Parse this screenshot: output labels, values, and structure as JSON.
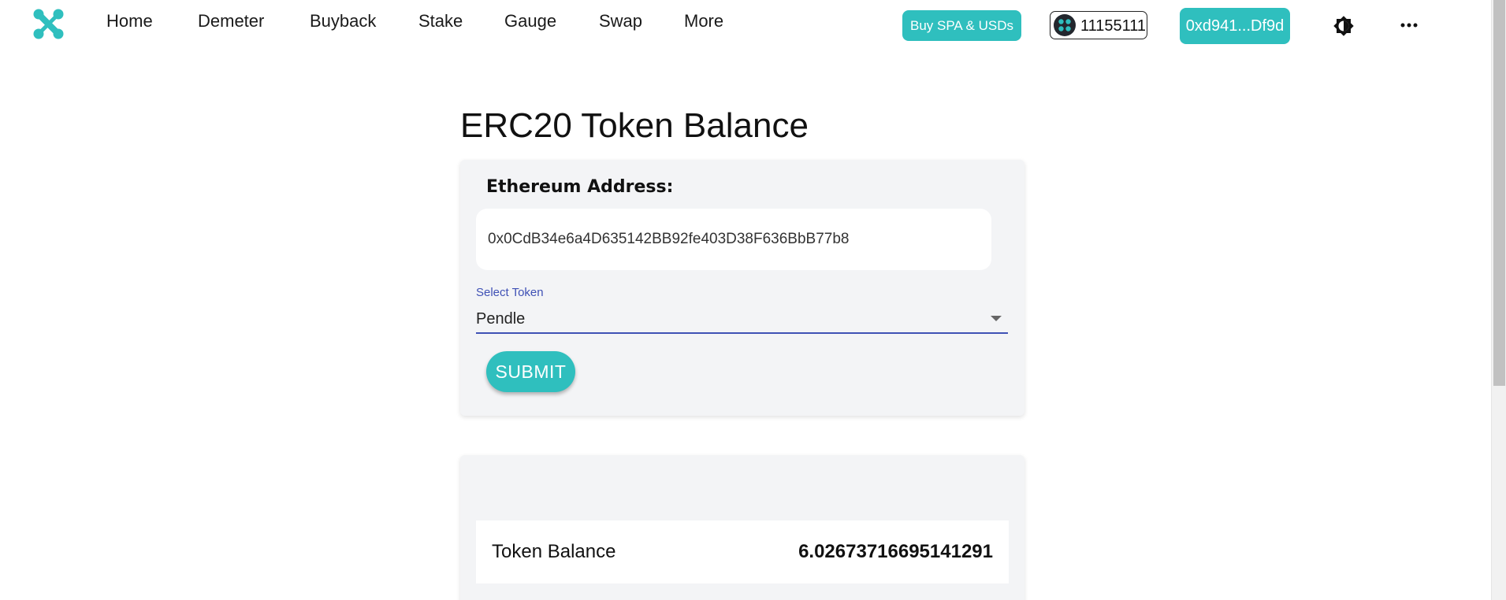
{
  "nav": {
    "logo_icon": "sperax-logo-icon",
    "links": [
      {
        "label": "Home"
      },
      {
        "label": "Demeter"
      },
      {
        "label": "Buyback"
      },
      {
        "label": "Stake"
      },
      {
        "label": "Gauge"
      },
      {
        "label": "Swap"
      },
      {
        "label": "More"
      }
    ],
    "buy_label": "Buy SPA & USDs",
    "chain_id": "11155111",
    "chain_icon": "network-icon",
    "account_label": "0xd941...Df9d",
    "theme_icon": "brightness-icon",
    "more_icon": "more-horizontal-icon"
  },
  "page": {
    "title": "ERC20 Token Balance"
  },
  "form": {
    "address_label": "Ethereum Address:",
    "address_value": "0x0CdB34e6a4D635142BB92fe403D38F636BbB77b8",
    "select_label": "Select Token",
    "select_value": "Pendle",
    "submit_label": "SUBMIT"
  },
  "result": {
    "label": "Token Balance",
    "value": "6.02673716695141291"
  },
  "colors": {
    "accent": "#2fbfbe",
    "select_underline": "#3f51b5",
    "card_bg": "#f3f4f6"
  }
}
